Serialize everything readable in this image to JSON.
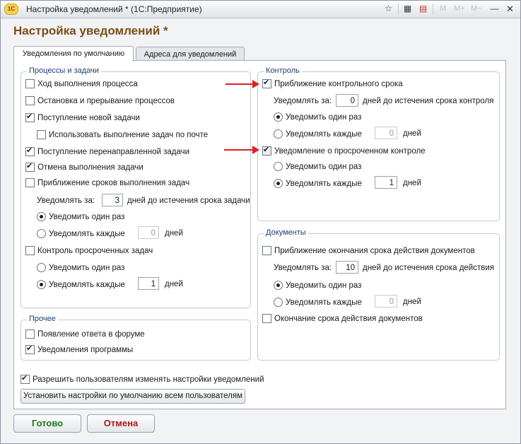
{
  "window": {
    "title": "Настройка уведомлений * (1С:Предприятие)",
    "logo_text": "1С",
    "toolbar": {
      "m": "M",
      "m_plus": "M+",
      "m_minus": "M−"
    }
  },
  "heading": "Настройка уведомлений *",
  "tabs": [
    "Уведомления по умолчанию",
    "Адреса для уведомлений"
  ],
  "processes": {
    "title": "Процессы и задачи",
    "items": [
      {
        "label": "Ход выполнения процесса",
        "checked": false
      },
      {
        "label": "Остановка и прерывание процессов",
        "checked": false
      },
      {
        "label": "Поступление новой задачи",
        "checked": true
      },
      {
        "label": "Использовать выполнение задач по почте",
        "checked": false
      },
      {
        "label": "Поступление перенаправленной задачи",
        "checked": true
      },
      {
        "label": "Отмена выполнения задачи",
        "checked": true
      },
      {
        "label": "Приближение сроков выполнения задач",
        "checked": false
      }
    ],
    "notify_label": "Уведомлять за:",
    "notify_value": "3",
    "notify_suffix": "дней до истечения срока задачи",
    "radio_once": "Уведомить один раз",
    "radio_each": "Уведомлять каждые",
    "each_value": "0",
    "days": "дней",
    "overdue_label": "Контроль просроченных задач",
    "overdue_radio_once": "Уведомить один раз",
    "overdue_radio_each": "Уведомлять каждые",
    "overdue_each_value": "1",
    "overdue_days": "дней"
  },
  "other": {
    "title": "Прочее",
    "items": [
      {
        "label": "Появление ответа в форуме",
        "checked": false
      },
      {
        "label": "Уведомления программы",
        "checked": true
      }
    ]
  },
  "control": {
    "title": "Контроль",
    "approach_label": "Приближение контрольного срока",
    "notify_label": "Уведомлять за:",
    "notify_value": "0",
    "notify_suffix": "дней до истечения срока контроля",
    "radio_once": "Уведомить один раз",
    "radio_each": "Уведомлять каждые",
    "each_value": "0",
    "days": "дней",
    "overdue_label": "Уведомление о просроченном контроле",
    "overdue_radio_once": "Уведомить один раз",
    "overdue_radio_each": "Уведомлять каждые",
    "overdue_each_value": "1",
    "overdue_days": "дней"
  },
  "documents": {
    "title": "Документы",
    "approach_label": "Приближение окончания срока действия документов",
    "notify_label": "Уведомлять за:",
    "notify_value": "10",
    "notify_suffix": "дней до истечения срока действия",
    "radio_once": "Уведомить один раз",
    "radio_each": "Уведомлять каждые",
    "each_value": "0",
    "days": "дней",
    "end_label": "Окончание срока действия документов"
  },
  "allow_users_label": "Разрешить пользователям изменять настройки уведомлений",
  "set_defaults_button": "Установить настройки по умолчанию всем пользователям",
  "ok_button": "Готово",
  "cancel_button": "Отмена",
  "colors": {
    "heading": "#7a4e14",
    "ok": "#1e7a1e",
    "cancel": "#b01616",
    "arrow": "#e02020",
    "group_title": "#1b3d78"
  }
}
